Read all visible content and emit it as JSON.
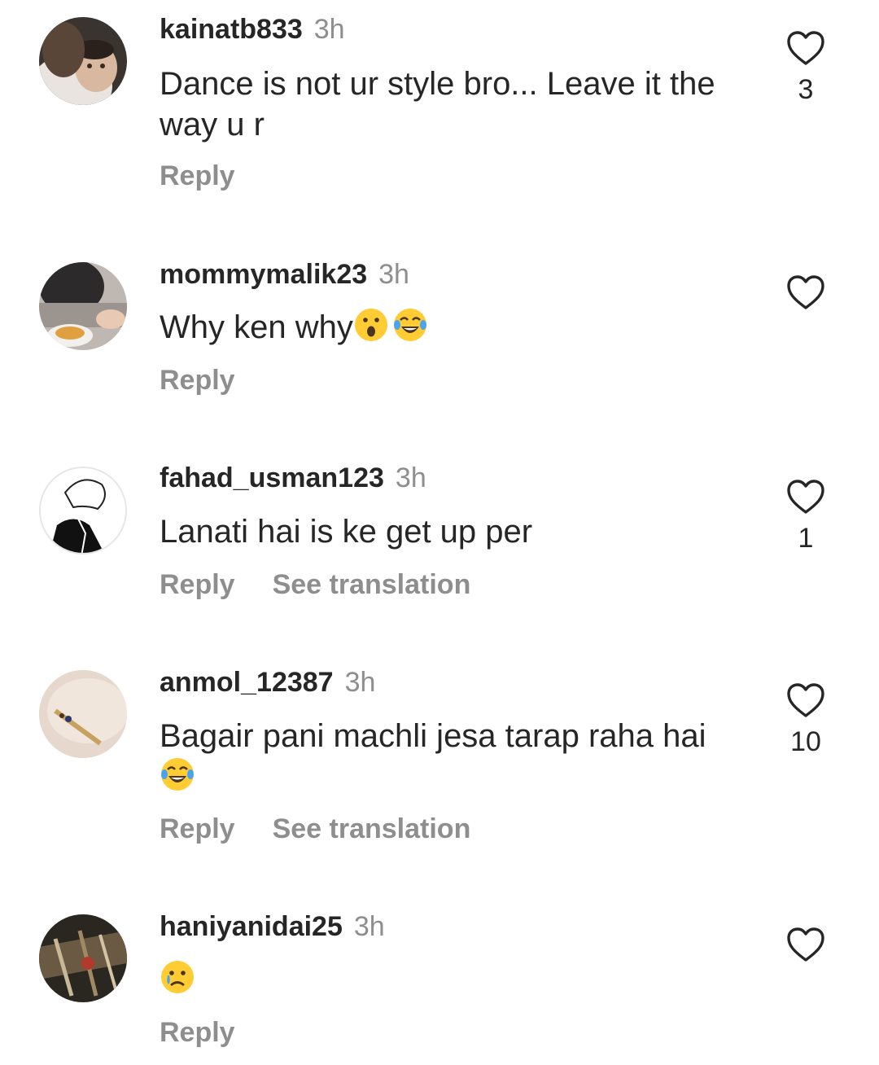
{
  "comments": [
    {
      "username": "kainatb833",
      "time": "3h",
      "text": "Dance is not ur style bro... Leave it the way u r",
      "reply_label": "Reply",
      "translate_label": "",
      "likes": "3"
    },
    {
      "username": "mommymalik23",
      "time": "3h",
      "text": "Why ken why",
      "emojis": [
        "surprised-emoji",
        "laughing-tears-emoji"
      ],
      "reply_label": "Reply",
      "translate_label": "",
      "likes": ""
    },
    {
      "username": "fahad_usman123",
      "time": "3h",
      "text": "Lanati hai is ke get up per",
      "reply_label": "Reply",
      "translate_label": "See translation",
      "likes": "1"
    },
    {
      "username": "anmol_12387",
      "time": "3h",
      "text": "Bagair pani machli jesa tarap raha hai",
      "emojis": [
        "laughing-tears-emoji"
      ],
      "reply_label": "Reply",
      "translate_label": "See translation",
      "likes": "10"
    },
    {
      "username": "haniyanidai25",
      "time": "3h",
      "text": "",
      "emojis": [
        "crying-sad-emoji"
      ],
      "reply_label": "Reply",
      "translate_label": "",
      "likes": ""
    }
  ],
  "icons": {
    "like": "heart-outline-icon"
  },
  "colors": {
    "text": "#262626",
    "secondary": "#8e8e8e",
    "background": "#ffffff"
  }
}
